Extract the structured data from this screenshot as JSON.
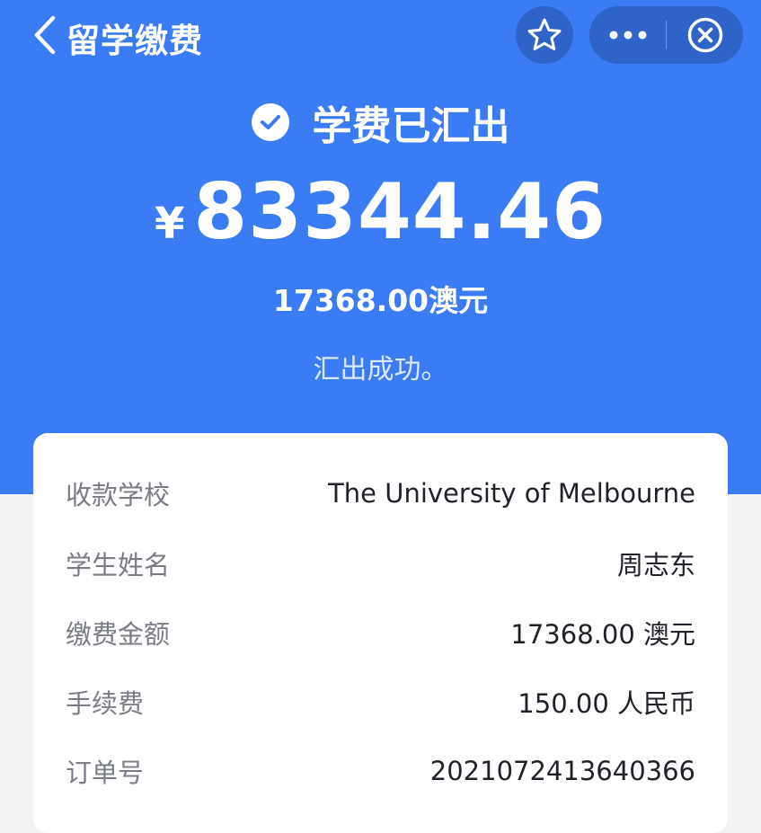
{
  "nav": {
    "title": "留学缴费",
    "back_icon": "chevron-left-icon",
    "favorite_icon": "star-outline-icon",
    "more_icon": "more-dots-icon",
    "close_icon": "close-circle-icon"
  },
  "summary": {
    "status_icon": "check-circle-icon",
    "status": "学费已汇出",
    "currency_symbol": "¥",
    "amount_cny": "83344.46",
    "amount_aud": "17368.00澳元",
    "note": "汇出成功。"
  },
  "details": [
    {
      "label": "收款学校",
      "value": "The University of Melbourne"
    },
    {
      "label": "学生姓名",
      "value": "周志东"
    },
    {
      "label": "缴费金额",
      "value": "17368.00 澳元"
    },
    {
      "label": "手续费",
      "value": "150.00 人民币"
    },
    {
      "label": "订单号",
      "value": "2021072413640366"
    }
  ],
  "colors": {
    "header_bg": "#3b7cf4",
    "capsule_bg": "#2f63c8",
    "page_bg": "#f2f3f5",
    "card_bg": "#ffffff",
    "label_text": "#7a7d86",
    "value_text": "#1f2329"
  }
}
